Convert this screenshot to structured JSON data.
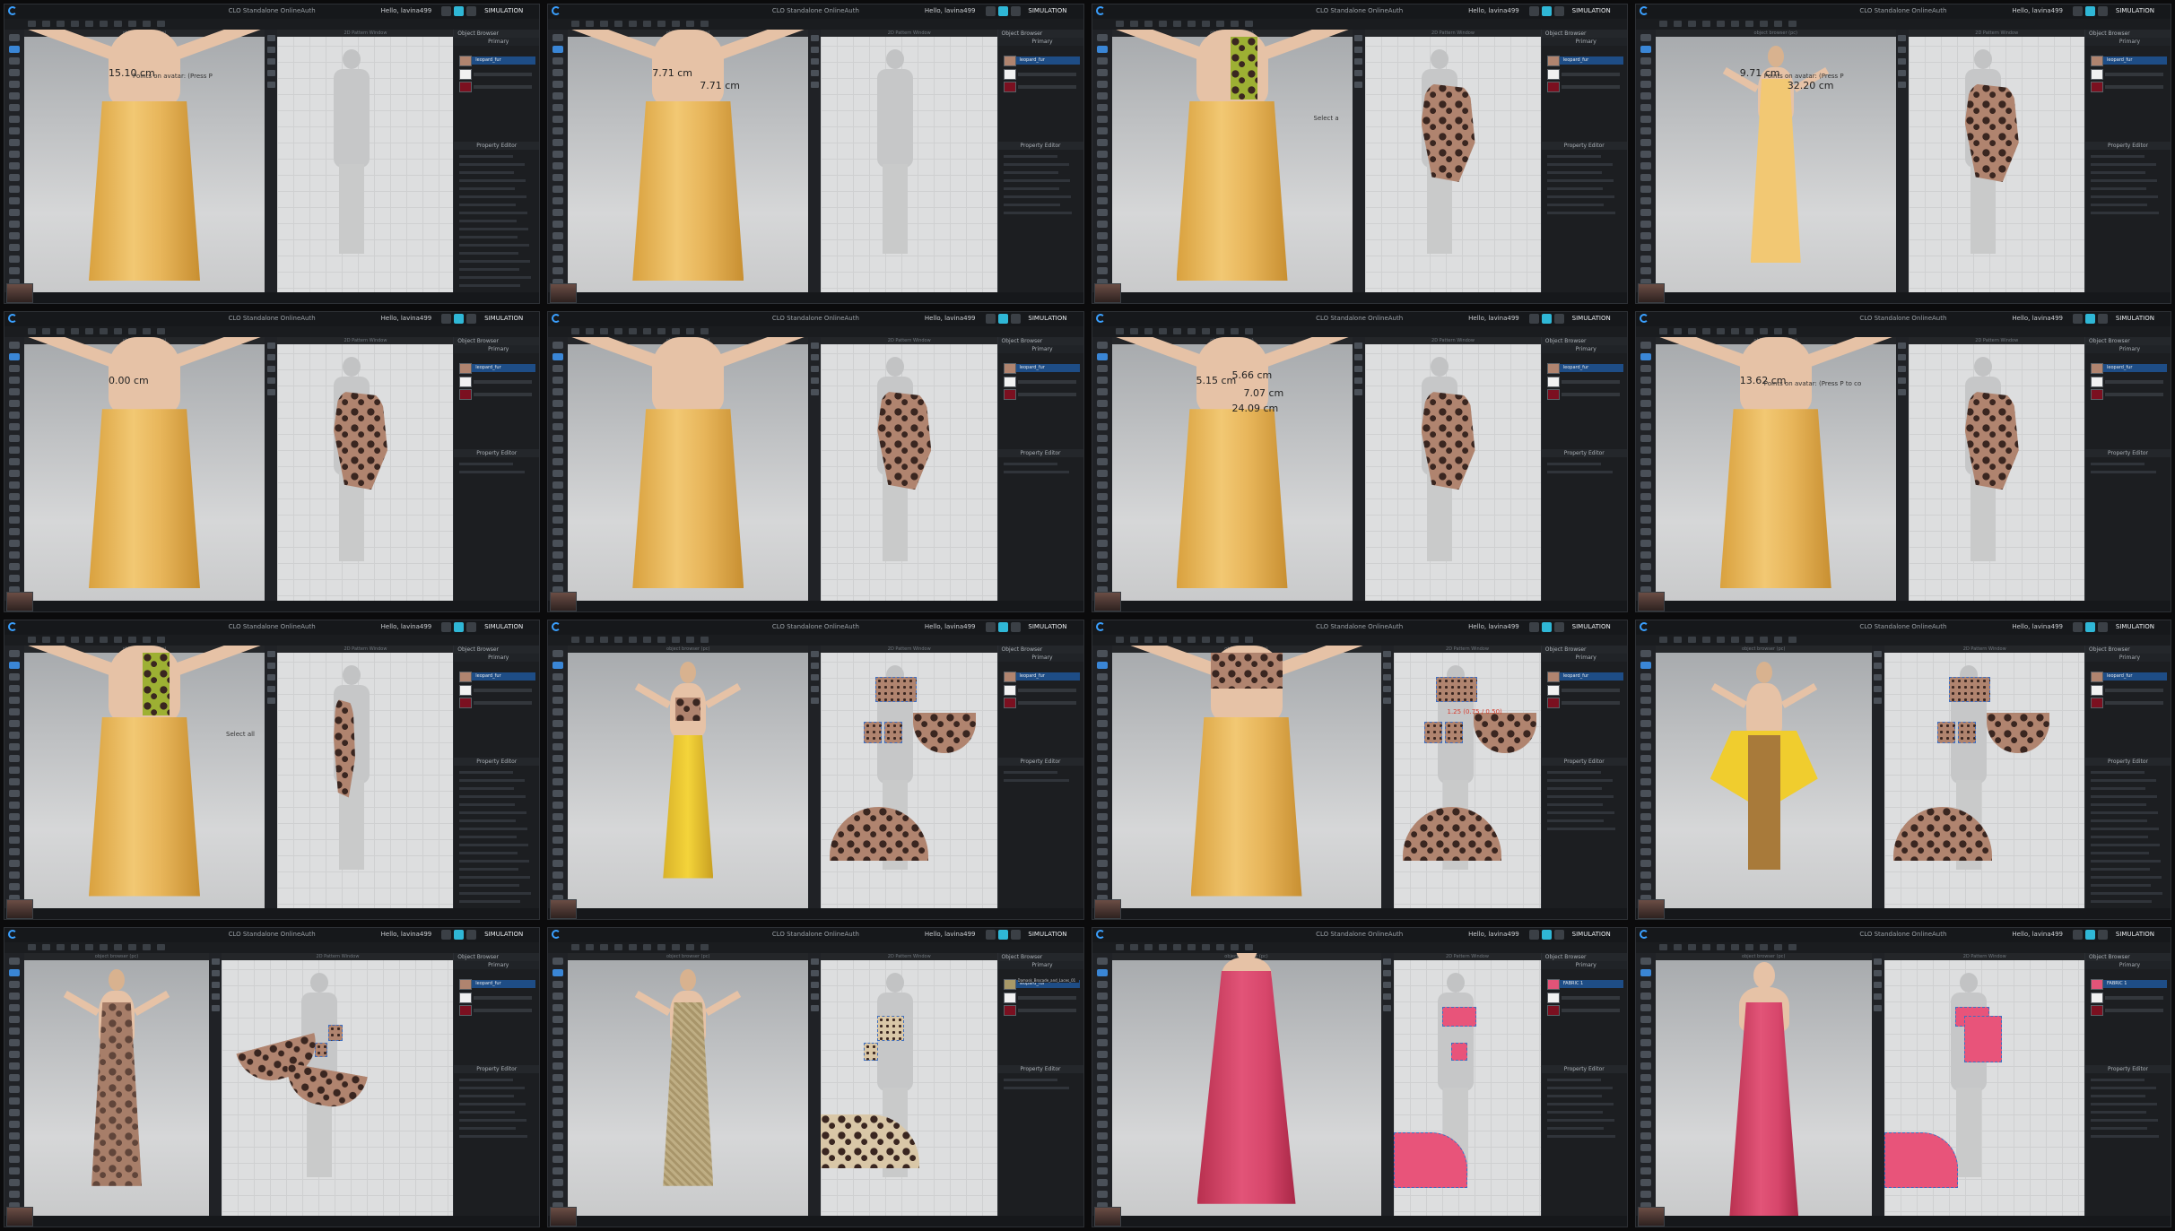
{
  "app": {
    "window_title": "CLO Standalone OnlineAuth",
    "user_greeting": "Hello, lavina499",
    "simulation_label": "SIMULATION",
    "view3d_title": "object browser (pc)",
    "view2d_title": "2D Pattern Window",
    "object_browser_title": "Object Browser",
    "property_editor_title": "Property Editor",
    "fabric_tab": "Primary",
    "fabric_name": "leopard_fur",
    "fabric_name_pink": "FABRIC 1"
  },
  "colors": {
    "accent": "#3aa0ff",
    "yellow_fabric": "#f2c873",
    "pink_fabric": "#e25478",
    "pattern_brown": "#b0846f",
    "seam_blue": "#3f6fc0",
    "selection_red": "#d83a2b"
  },
  "tiles": [
    {
      "measure": [
        "15.10 cm"
      ],
      "hint": "Points on avatar: (Press P"
    },
    {
      "measure": [
        "7.71 cm",
        "7.71 cm"
      ],
      "hint": ""
    },
    {
      "measure": [],
      "hint": "Select a"
    },
    {
      "measure": [
        "9.71 cm",
        "32.20 cm"
      ],
      "hint": "Points on avatar: (Press P"
    },
    {
      "measure": [
        "0.00 cm"
      ],
      "hint": ""
    },
    {
      "measure": [],
      "hint": ""
    },
    {
      "measure": [
        "5.15 cm",
        "7.07 cm",
        "5.66 cm",
        "24.09 cm"
      ],
      "hint": ""
    },
    {
      "measure": [
        "13.62 cm"
      ],
      "hint": "Points on avatar: (Press P to co"
    },
    {
      "measure": [],
      "hint": "Select all"
    },
    {
      "measure": [],
      "hint": ""
    },
    {
      "measure": [],
      "hint": "",
      "red_label": "1.25 (0.75 / 0.50)"
    },
    {
      "measure": [],
      "hint": ""
    },
    {
      "measure": [],
      "hint": ""
    },
    {
      "measure": [],
      "hint": "",
      "library_item": "Damask_Brocade_and_Laces_01"
    },
    {
      "measure": [],
      "hint": ""
    },
    {
      "measure": [],
      "hint": ""
    }
  ]
}
